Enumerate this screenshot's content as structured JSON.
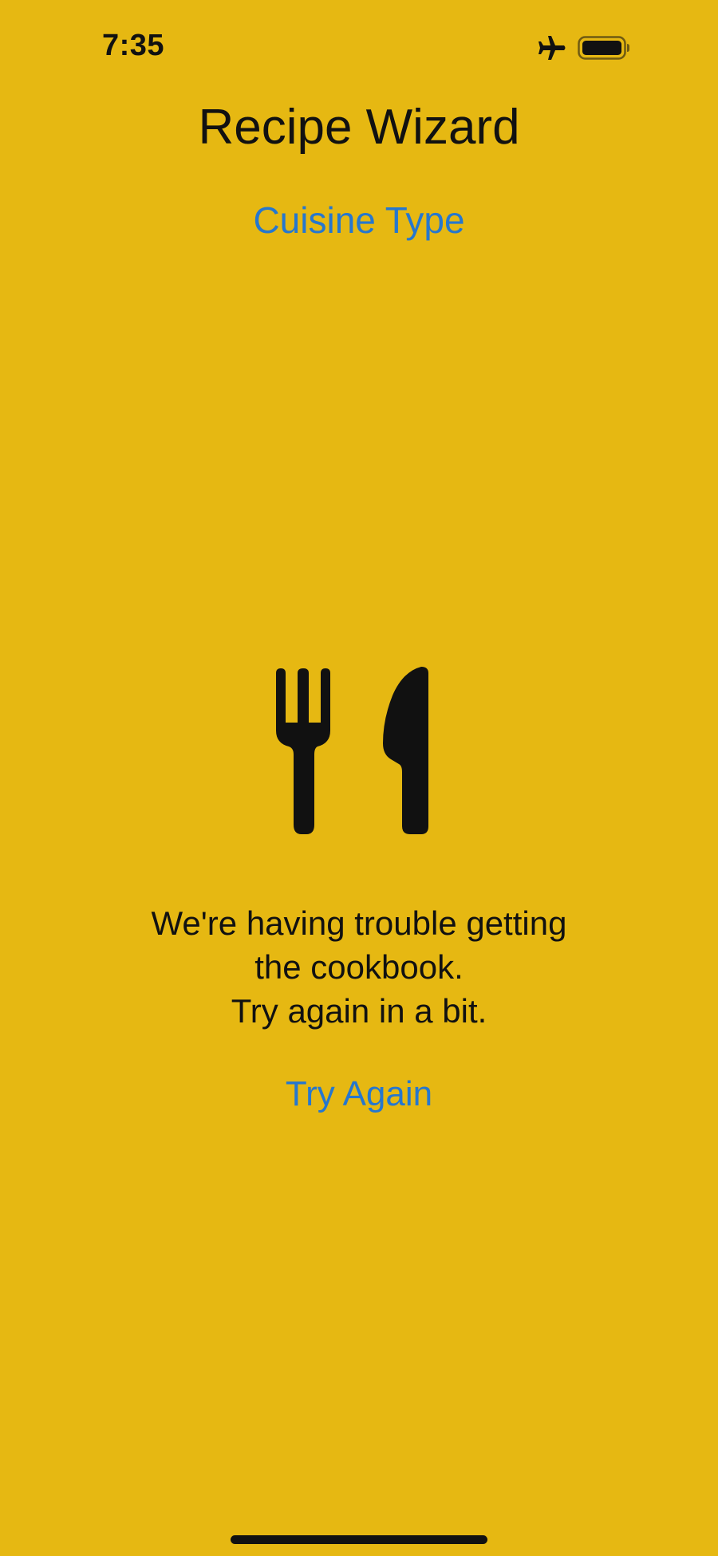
{
  "status_bar": {
    "time": "7:35",
    "icons": [
      "airplane-icon",
      "battery-icon"
    ]
  },
  "header": {
    "title": "Recipe Wizard",
    "cuisine_link": "Cuisine Type"
  },
  "main": {
    "icon": "fork-knife-icon",
    "error_lines": [
      "We're having trouble getting",
      "the cookbook.",
      "Try again in a bit."
    ],
    "retry_label": "Try Again"
  },
  "colors": {
    "background": "#E6B812",
    "link": "#2677CE",
    "text": "#111111"
  }
}
